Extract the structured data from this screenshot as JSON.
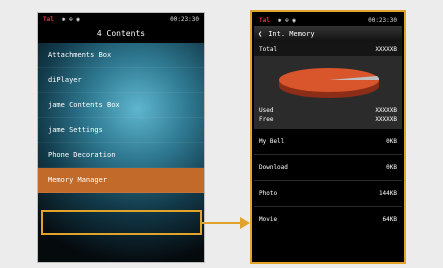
{
  "left_phone": {
    "status": {
      "signal": "Tal",
      "icons": "✱ ⊕ ◉",
      "time": "00:23:30"
    },
    "title": "4 Contents",
    "menu": [
      "Attachments Box",
      "diPlayer",
      "jame Contents Box",
      "jame Settings",
      "Phone Decoration",
      "Memory Manager"
    ],
    "selected_index": 5
  },
  "right_phone": {
    "status": {
      "signal": "Tal",
      "icons": "✱ ⊕ ◉",
      "time": "00:23:30"
    },
    "back_icon": "chevron-left-icon",
    "title": "Int. Memory",
    "total": {
      "label": "Total",
      "value": "XXXXXB"
    },
    "used": {
      "label": "Used",
      "value": "XXXXXB"
    },
    "free": {
      "label": "Free",
      "value": "XXXXXB"
    },
    "items": [
      {
        "label": "My Bell",
        "value": "0KB"
      },
      {
        "label": "Download",
        "value": "0KB"
      },
      {
        "label": "Photo",
        "value": "144KB"
      },
      {
        "label": "Movie",
        "value": "64KB"
      }
    ],
    "colors": {
      "used": "#d9552b",
      "free": "#bfbfbf"
    }
  },
  "colors": {
    "highlight": "#e2a32a",
    "selected_row": "#c26a2a"
  }
}
